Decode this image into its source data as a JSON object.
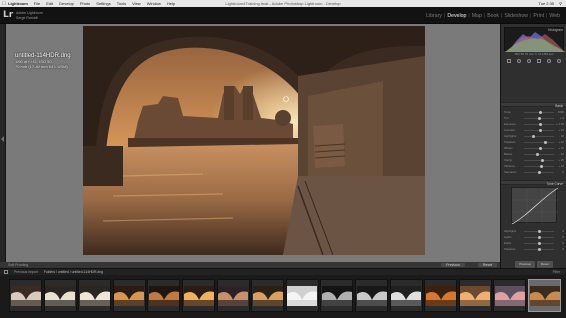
{
  "menubar": {
    "app": "Lightroom",
    "items": [
      "File",
      "Edit",
      "Develop",
      "Photo",
      "Settings",
      "Tools",
      "View",
      "Window",
      "Help"
    ],
    "window_title": "Lightroom4Training.lrcat - Adobe Photoshop Lightroom - Develop",
    "clock": "Tue 2:35"
  },
  "identity": {
    "line1": "Adobe Lightroom",
    "line2": "Serge Ramelli"
  },
  "modules": [
    "Library",
    "Develop",
    "Map",
    "Book",
    "Slideshow",
    "Print",
    "Web"
  ],
  "active_module": "Develop",
  "photo_info": {
    "filename": "untitled-114HDR.dng",
    "line2": "1/60 at f / 11, ISO 50",
    "line3": "70 mm (17-40 mm f/4 L USM)"
  },
  "toolbar": {
    "softproof": "Soft Proofing",
    "previous": "Previous",
    "reset": "Reset"
  },
  "right_panel": {
    "histogram_title": "Histogram",
    "histogram_info": "ISO 50    70 mm    f / 11    1/60 sec",
    "basic_title": "Basic",
    "tone_curve_title": "Tone Curve",
    "sliders": [
      {
        "label": "Temp",
        "value": "4800",
        "pos": 0.55
      },
      {
        "label": "Tint",
        "value": "+ 6",
        "pos": 0.52
      },
      {
        "label": "Exposure",
        "value": "+ 0.35",
        "pos": 0.55
      },
      {
        "label": "Contrast",
        "value": "+ 12",
        "pos": 0.56
      },
      {
        "label": "Highlights",
        "value": "- 48",
        "pos": 0.3
      },
      {
        "label": "Shadows",
        "value": "+ 42",
        "pos": 0.7
      },
      {
        "label": "Whites",
        "value": "+ 10",
        "pos": 0.55
      },
      {
        "label": "Blacks",
        "value": "- 12",
        "pos": 0.45
      },
      {
        "label": "Clarity",
        "value": "+ 25",
        "pos": 0.62
      },
      {
        "label": "Vibrance",
        "value": "+ 18",
        "pos": 0.58
      },
      {
        "label": "Saturation",
        "value": "0",
        "pos": 0.5
      }
    ],
    "curve_sliders": [
      {
        "label": "Highlights",
        "value": "0",
        "pos": 0.5
      },
      {
        "label": "Lights",
        "value": "0",
        "pos": 0.5
      },
      {
        "label": "Darks",
        "value": "0",
        "pos": 0.5
      },
      {
        "label": "Shadows",
        "value": "0",
        "pos": 0.5
      }
    ]
  },
  "filmstrip_bar": {
    "label": "Previous Import",
    "path": "Folders / untitled / untitled-114HDR.dng",
    "filter": "Filter :"
  },
  "filmstrip": {
    "count": 16,
    "selected_index": 15
  },
  "colors": {
    "sky": "#c98a4a",
    "bridge": "#3c2b20",
    "water": "#b07a4a"
  }
}
